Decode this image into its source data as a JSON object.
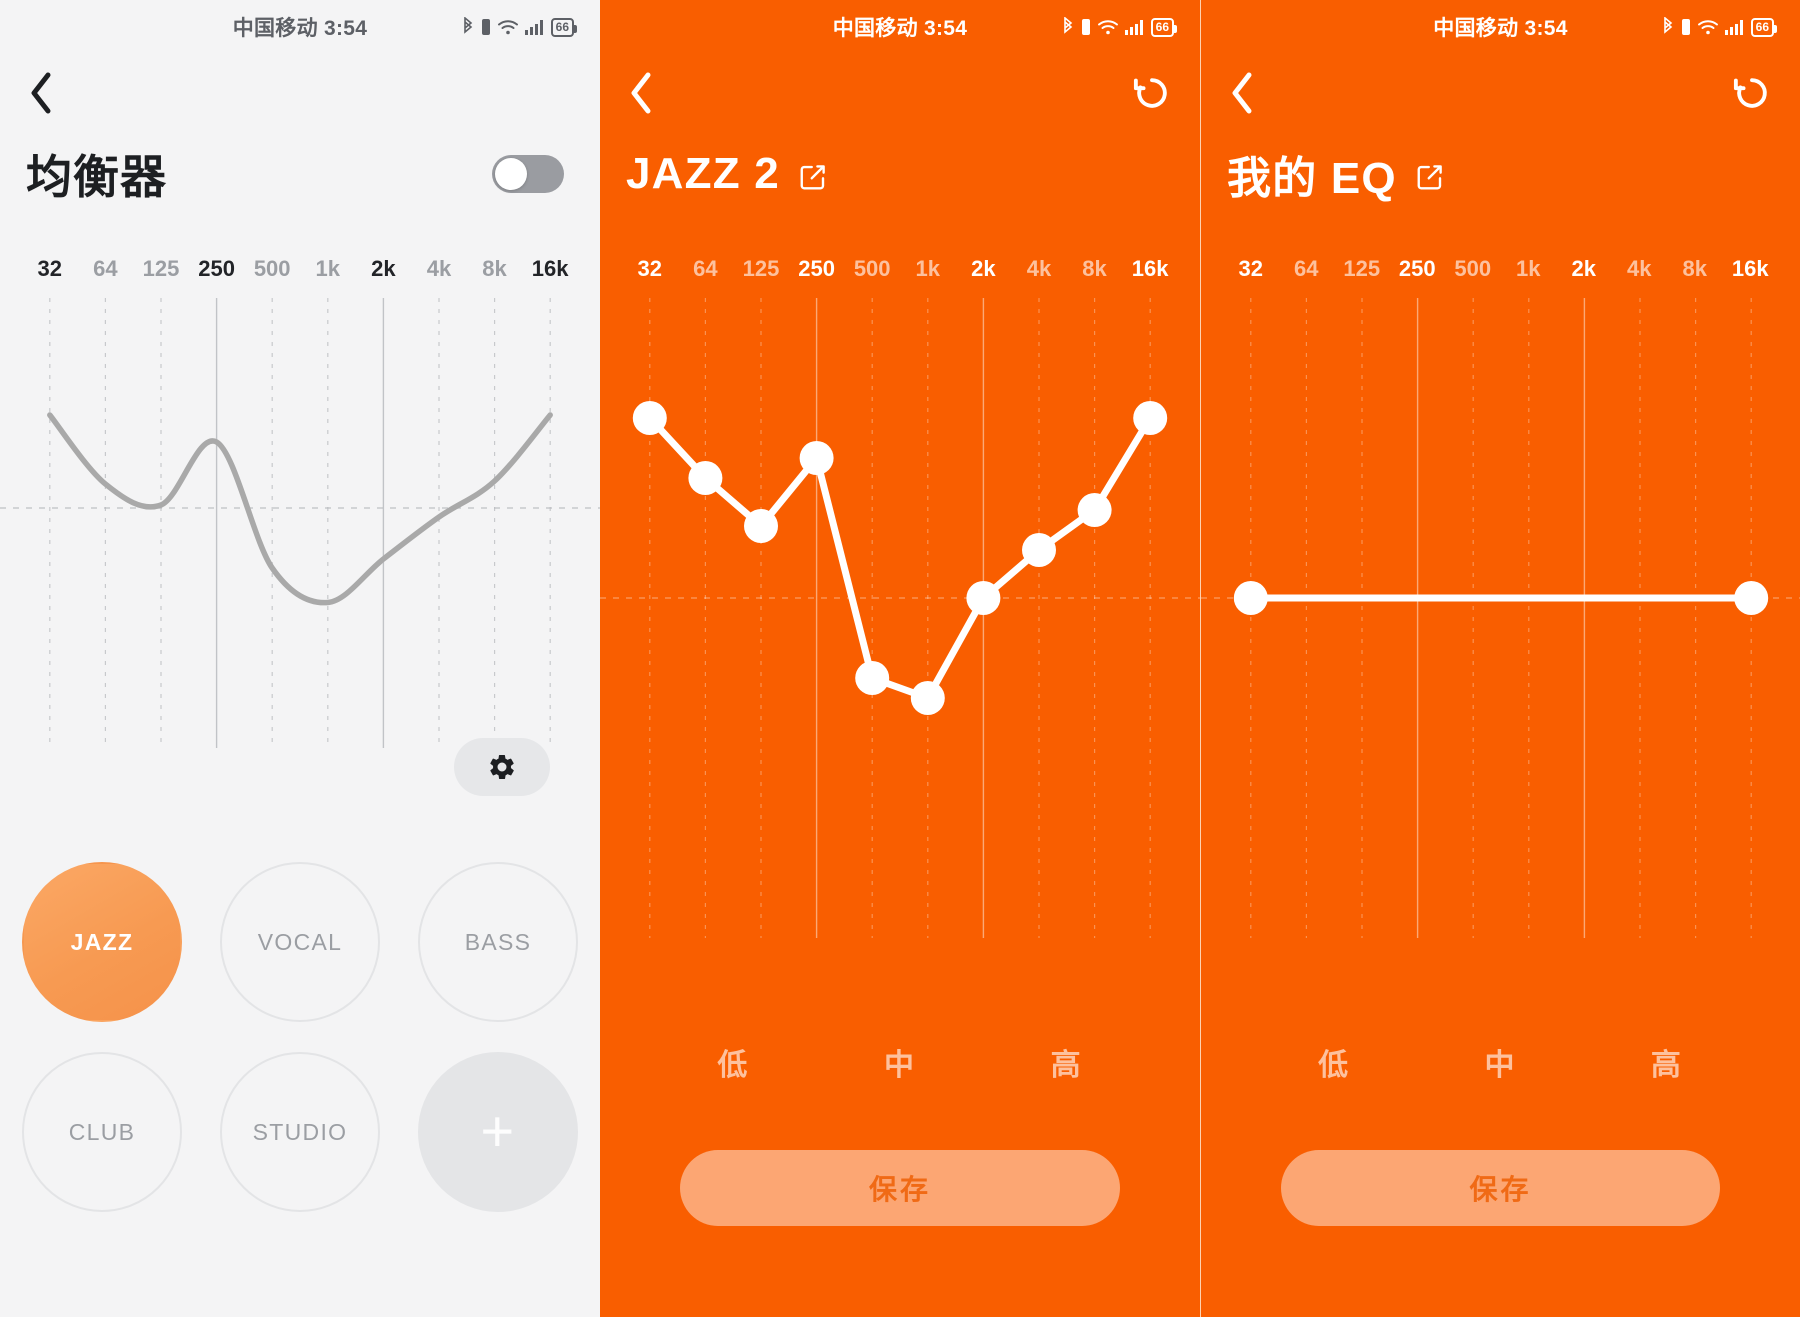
{
  "statusbar": {
    "carrier_time": "中国移动 3:54",
    "battery_level": "66",
    "icons": [
      "bluetooth-icon",
      "vibrate-icon",
      "wifi-icon",
      "signal-icon",
      "battery-icon"
    ]
  },
  "panel1": {
    "title": "均衡器",
    "back_label": "返回",
    "toggle_state": "off",
    "gear_label": "设置",
    "freq_labels": [
      "32",
      "64",
      "125",
      "250",
      "500",
      "1k",
      "2k",
      "4k",
      "8k",
      "16k"
    ],
    "freq_strong": [
      true,
      false,
      false,
      true,
      false,
      false,
      true,
      false,
      false,
      true
    ],
    "presets": [
      {
        "label": "JAZZ",
        "active": true
      },
      {
        "label": "VOCAL",
        "active": false
      },
      {
        "label": "BASS",
        "active": false
      },
      {
        "label": "CLUB",
        "active": false
      },
      {
        "label": "STUDIO",
        "active": false
      },
      {
        "label": "+",
        "active": false,
        "is_add": true
      }
    ]
  },
  "panel2": {
    "title": "JAZZ 2",
    "reset_label": "重置",
    "freq_labels": [
      "32",
      "64",
      "125",
      "250",
      "500",
      "1k",
      "2k",
      "4k",
      "8k",
      "16k"
    ],
    "freq_strong": [
      true,
      false,
      false,
      true,
      false,
      false,
      true,
      false,
      false,
      true
    ],
    "band_labels": [
      "低",
      "中",
      "高"
    ],
    "save_label": "保存"
  },
  "panel3": {
    "title": "我的 EQ",
    "reset_label": "重置",
    "freq_labels": [
      "32",
      "64",
      "125",
      "250",
      "500",
      "1k",
      "2k",
      "4k",
      "8k",
      "16k"
    ],
    "freq_strong": [
      true,
      false,
      false,
      true,
      false,
      false,
      true,
      false,
      false,
      true
    ],
    "band_labels": [
      "低",
      "中",
      "高"
    ],
    "save_label": "保存"
  },
  "colors": {
    "orange_bg": "#f95e00",
    "light_bg": "#f4f4f5",
    "accent_preset": "#f79a52",
    "save_text": "#f06a15",
    "curve_grey": "#a9a9a9"
  },
  "chart_data": [
    {
      "id": "panel1-curve",
      "type": "line",
      "title": "均衡器",
      "categories": [
        "32",
        "64",
        "125",
        "250",
        "500",
        "1k",
        "2k",
        "4k",
        "8k",
        "16k"
      ],
      "values": [
        6.2,
        1.6,
        0.2,
        4.4,
        -4.0,
        -6.3,
        -3.4,
        -0.6,
        1.8,
        6.2
      ],
      "ylim": [
        -12,
        12
      ],
      "grid": true,
      "legend": "none",
      "xlabel": "",
      "ylabel": "",
      "style": "smooth-grey-no-markers"
    },
    {
      "id": "panel2-curve",
      "type": "line",
      "title": "JAZZ 2",
      "categories": [
        "32",
        "64",
        "125",
        "250",
        "500",
        "1k",
        "2k",
        "4k",
        "8k",
        "16k"
      ],
      "values": [
        9.0,
        6.0,
        3.6,
        7.0,
        -4.0,
        -5.0,
        0.0,
        2.4,
        4.4,
        9.0
      ],
      "ylim": [
        -12,
        12
      ],
      "grid": true,
      "legend": "none",
      "xlabel": "",
      "ylabel": "",
      "style": "white-line-with-round-markers"
    },
    {
      "id": "panel3-curve",
      "type": "line",
      "title": "我的 EQ",
      "categories": [
        "32",
        "64",
        "125",
        "250",
        "500",
        "1k",
        "2k",
        "4k",
        "8k",
        "16k"
      ],
      "values": [
        0,
        0,
        0,
        0,
        0,
        0,
        0,
        0,
        0,
        0
      ],
      "ylim": [
        -12,
        12
      ],
      "grid": true,
      "legend": "none",
      "xlabel": "",
      "ylabel": "",
      "style": "flat-white-line-endpoint-markers"
    }
  ]
}
